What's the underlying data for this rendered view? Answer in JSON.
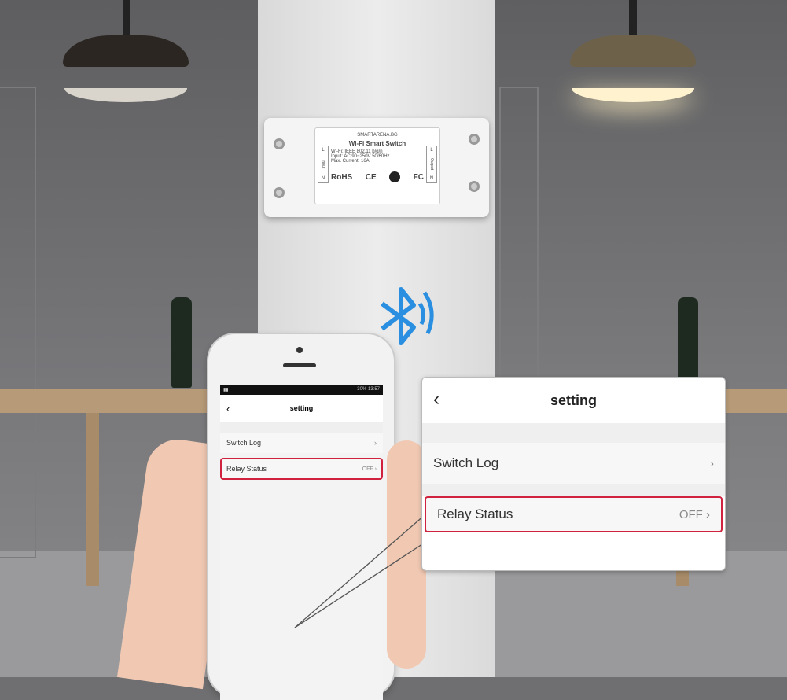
{
  "device": {
    "brand": "SMARTARENA.BG",
    "title": "Wi-Fi Smart Switch",
    "specs": [
      "Wi-Fi: IEEE 802.11 b/g/n",
      "Input: AC 90~250V 50/60Hz",
      "Max. Current: 16A"
    ],
    "input_label": "Input",
    "output_label": "Output",
    "l": "L",
    "n": "N",
    "rohs": "RoHS",
    "ce": "CE",
    "fcc": "FC"
  },
  "phone": {
    "status_time": "13:57",
    "status_battery": "30%",
    "header": {
      "back_icon": "chevron-left-icon",
      "title": "setting"
    },
    "items": [
      {
        "label": "Switch Log",
        "value": ""
      },
      {
        "label": "Relay Status",
        "value": "OFF"
      }
    ]
  },
  "callout": {
    "header": {
      "back_icon": "chevron-left-icon",
      "title": "setting"
    },
    "items": [
      {
        "label": "Switch Log",
        "value": ""
      },
      {
        "label": "Relay Status",
        "value": "OFF",
        "highlighted": true
      }
    ]
  },
  "colors": {
    "highlight": "#d0213e",
    "bluetooth": "#2a8fe0"
  },
  "icons": [
    "bluetooth-icon",
    "chevron-right-icon",
    "chevron-left-icon"
  ]
}
